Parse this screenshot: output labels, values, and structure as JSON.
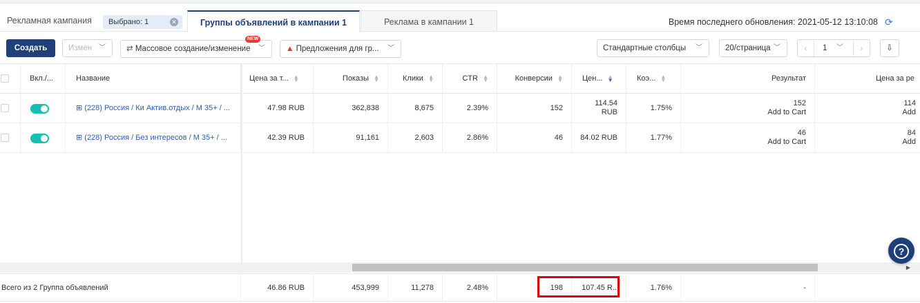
{
  "tabs": {
    "campaign": "Рекламная кампания",
    "selected_badge": "Выбрано: 1",
    "groups": "Группы объявлений в кампании 1",
    "ads": "Реклама в кампании 1"
  },
  "update_time": "Время последнего обновления: 2021-05-12 13:10:08",
  "toolbar": {
    "create": "Создать",
    "edit": "Измен",
    "mass": "Массовое создание/изменение",
    "new_badge": "NEW",
    "suggestions": "Предложения для гр...",
    "columns": "Стандартные столбцы",
    "per_page": "20/страница",
    "page": "1"
  },
  "columns": {
    "on": "Вкл./...",
    "name": "Название",
    "cpm": "Цена за т...",
    "impressions": "Показы",
    "clicks": "Клики",
    "ctr": "CTR",
    "conversions": "Конверсии",
    "cost_conv": "Цен...",
    "conv_rate": "Коэ...",
    "result": "Результат",
    "cost_result": "Цена за ре"
  },
  "rows": [
    {
      "name": "(228) Россия / Ки Актив.отдых / М 35+ / ...",
      "cpm": "47.98 RUB",
      "impressions": "362,838",
      "clicks": "8,675",
      "ctr": "2.39%",
      "conversions": "152",
      "cost_conv_1": "114.54",
      "cost_conv_2": "RUB",
      "conv_rate": "1.75%",
      "result_1": "152",
      "result_2": "Add to Cart",
      "cost_result_1": "114",
      "cost_result_2": "Add"
    },
    {
      "name": "(228) Россия / Без интересов / М 35+ / ...",
      "cpm": "42.39 RUB",
      "impressions": "91,161",
      "clicks": "2,603",
      "ctr": "2.86%",
      "conversions": "46",
      "cost_conv": "84.02 RUB",
      "conv_rate": "1.77%",
      "result_1": "46",
      "result_2": "Add to Cart",
      "cost_result_1": "84",
      "cost_result_2": "Add"
    }
  ],
  "totals": {
    "label": "Всего из 2 Группа объявлений",
    "cpm": "46.86 RUB",
    "impressions": "453,999",
    "clicks": "11,278",
    "ctr": "2.48%",
    "conversions": "198",
    "cost_conv": "107.45 R...",
    "conv_rate": "1.76%",
    "result": "-"
  },
  "colors": {
    "primary": "#1f3f79",
    "toggle_on": "#16bfb0",
    "link": "#2d5fb5",
    "highlight": "#e00000"
  }
}
